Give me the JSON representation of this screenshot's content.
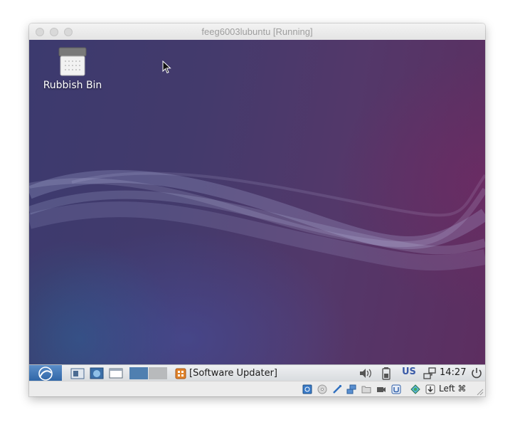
{
  "window": {
    "title": "feeg6003lubuntu [Running]"
  },
  "desktop": {
    "icons": [
      {
        "label": "Rubbish Bin",
        "icon": "trash-icon"
      }
    ]
  },
  "panel": {
    "taskbar_item": "[Software Updater]",
    "keyboard_layout": "US",
    "clock": "14:27"
  },
  "statusbar": {
    "host_key": "Left ⌘"
  },
  "colors": {
    "accent": "#2f65a6",
    "desktop_left": "#3c3a6e",
    "desktop_right": "#5d2e60"
  }
}
